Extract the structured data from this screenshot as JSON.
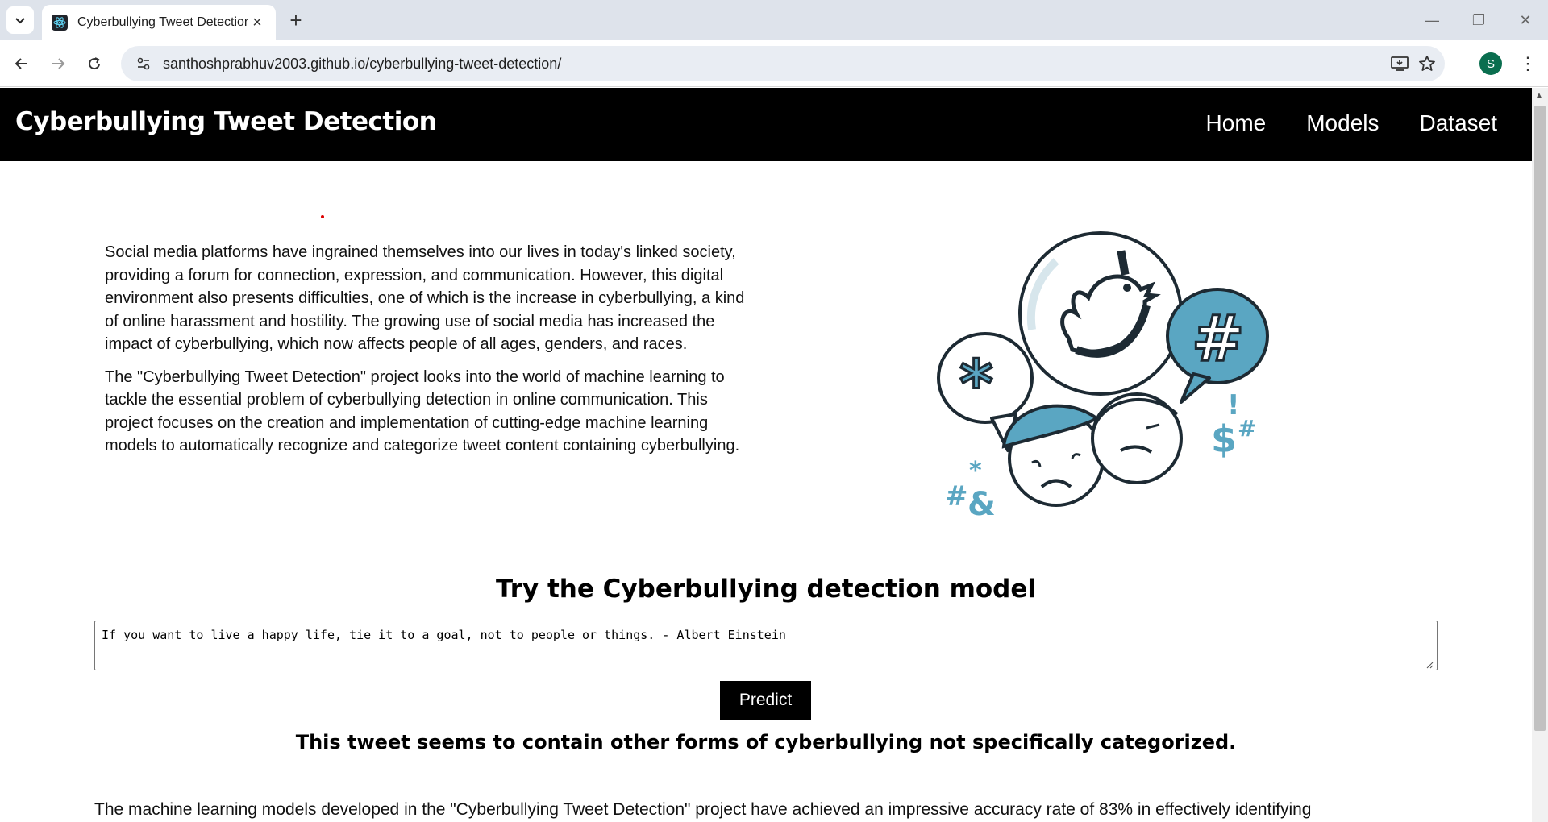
{
  "browser": {
    "tab_title": "Cyberbullying Tweet Detection",
    "url": "santhoshprabhuv2003.github.io/cyberbullying-tweet-detection/",
    "profile_initial": "S"
  },
  "header": {
    "title": "Cyberbullying Tweet Detection",
    "nav": [
      "Home",
      "Models",
      "Dataset"
    ]
  },
  "intro": {
    "paragraphs": [
      "Social media platforms have ingrained themselves into our lives in today's linked society, providing a forum for connection, expression, and communication. However, this digital environment also presents difficulties, one of which is the increase in cyberbullying, a kind of online harassment and hostility. The growing use of social media has increased the impact of cyberbullying, which now affects people of all ages, genders, and races.",
      "The \"Cyberbullying Tweet Detection\" project looks into the world of machine learning to tackle the essential problem of cyberbullying detection in online communication. This project focuses on the creation and implementation of cutting-edge machine learning models to automatically recognize and categorize tweet content containing cyberbullying."
    ]
  },
  "illustration": {
    "icon": "cyberbullying-illustration",
    "accent_color": "#5aa6c2"
  },
  "model_section": {
    "title": "Try the Cyberbullying detection model",
    "input_value": "If you want to live a happy life, tie it to a goal, not to people or things. - Albert Einstein",
    "button_label": "Predict",
    "result": "This tweet seems to contain other forms of cyberbullying not specifically categorized."
  },
  "accuracy_text": "The machine learning models developed in the \"Cyberbullying Tweet Detection\" project have achieved an impressive accuracy rate of 83% in effectively identifying"
}
